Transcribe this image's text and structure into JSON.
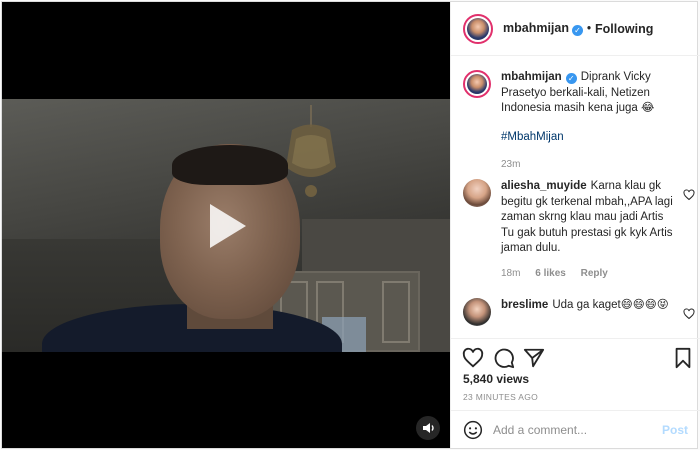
{
  "header": {
    "username": "mbahmijan",
    "separator": "•",
    "follow_status": "Following"
  },
  "caption": {
    "username": "mbahmijan",
    "text": "Diprank Vicky Prasetyo berkali-kali, Netizen Indonesia masih kena juga 😂",
    "hashtag": "#MbahMijan",
    "time": "23m"
  },
  "comments": [
    {
      "username": "aliesha_muyide",
      "text": "Karna klau gk begitu gk terkenal mbah,,APA lagi zaman skrng klau mau jadi Artis Tu gak butuh prestasi gk kyk Artis jaman dulu.",
      "time": "18m",
      "likes": "6 likes",
      "reply": "Reply"
    },
    {
      "username": "breslime",
      "text": "Uda ga kaget😄😄😄😝"
    }
  ],
  "stats": {
    "views": "5,840 views",
    "ago": "23 MINUTES AGO"
  },
  "add_comment": {
    "placeholder": "Add a comment...",
    "post_label": "Post"
  },
  "colors": {
    "verified": "#3897f0",
    "hashtag": "#00376b",
    "post_disabled": "#b3dbff",
    "story_ring": "#e1306c"
  },
  "icons": {
    "play": "play-icon",
    "sound": "speaker-icon",
    "like": "heart-icon",
    "comment": "comment-bubble-icon",
    "share": "paper-plane-icon",
    "save": "bookmark-icon",
    "emoji": "smiley-icon",
    "verified": "verified-badge-icon"
  }
}
